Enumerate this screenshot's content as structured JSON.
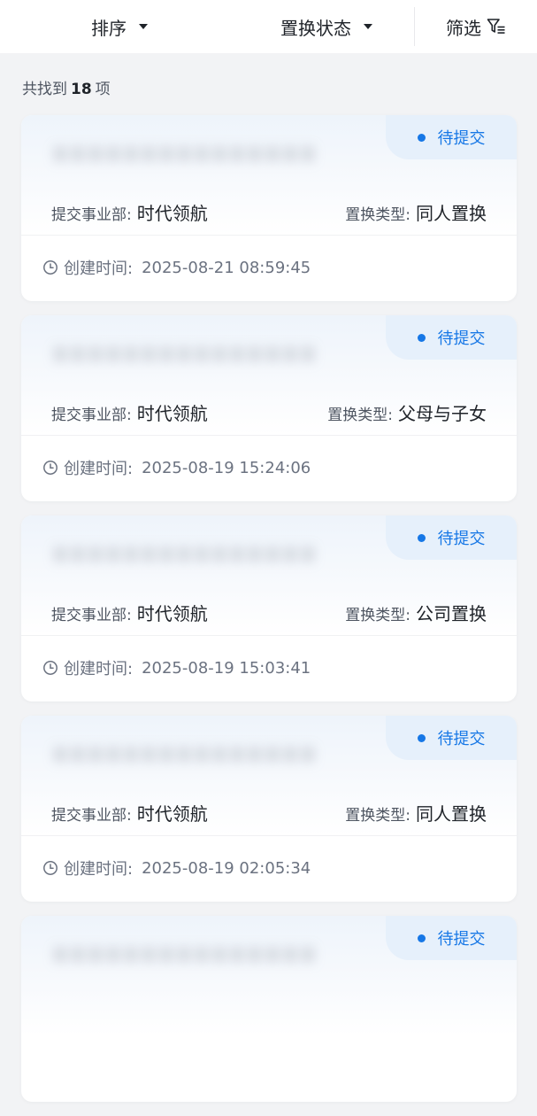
{
  "toolbar": {
    "sort_label": "排序",
    "status_label": "置换状态",
    "filter_label": "筛选"
  },
  "summary": {
    "prefix": "共找到",
    "count": "18",
    "suffix": "项"
  },
  "labels": {
    "department": "提交事业部:",
    "type": "置换类型:",
    "created": "创建时间:"
  },
  "cards": [
    {
      "title": "ＸＸＸＸＸＸＸＸＸＸＸＸＸＸＸ",
      "status": "待提交",
      "department": "时代领航",
      "type": "同人置换",
      "created_at": "2025-08-21 08:59:45"
    },
    {
      "title": "ＸＸＸＸＸＸＸＸＸＸＸＸＸＸＸ",
      "status": "待提交",
      "department": "时代领航",
      "type": "父母与子女",
      "created_at": "2025-08-19 15:24:06"
    },
    {
      "title": "ＸＸＸＸＸＸＸＸＸＸＸＸＸＸＸ",
      "status": "待提交",
      "department": "时代领航",
      "type": "公司置换",
      "created_at": "2025-08-19 15:03:41"
    },
    {
      "title": "ＸＸＸＸＸＸＸＸＸＸＸＸＸＸＸ",
      "status": "待提交",
      "department": "时代领航",
      "type": "同人置换",
      "created_at": "2025-08-19 02:05:34"
    },
    {
      "title": "ＸＸＸＸＸＸＸＸＸＸＸＸＸＸＸ",
      "status": "待提交"
    }
  ],
  "colors": {
    "accent": "#1677e6",
    "badge_bg": "#e6f0fb",
    "page_bg": "#f2f3f5"
  },
  "icons": [
    "caret-down-icon",
    "filter-icon",
    "clock-icon",
    "status-dot-icon"
  ]
}
